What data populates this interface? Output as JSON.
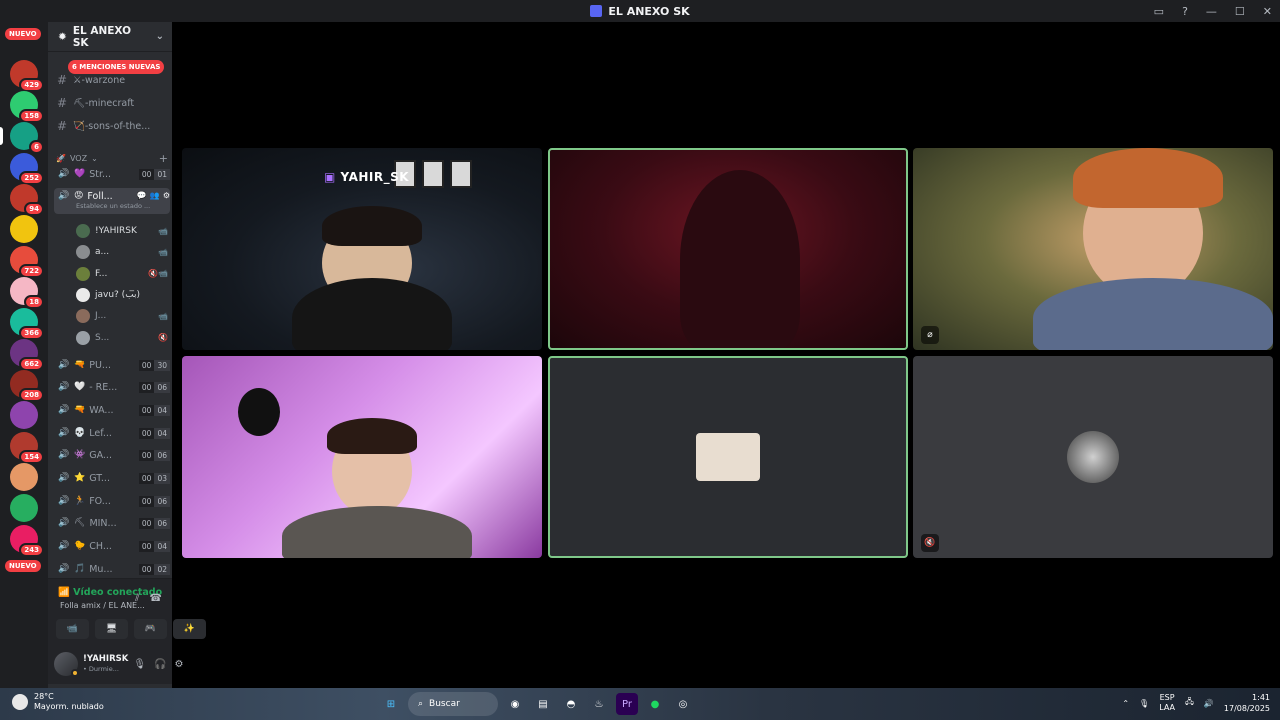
{
  "window": {
    "title": "EL ANEXO SK"
  },
  "rail": {
    "top_badge": "NUEVO",
    "bottom_badge": "NUEVO",
    "servers": [
      {
        "badge": "429",
        "color": "#c0392b"
      },
      {
        "badge": "158",
        "color": "#2ecc71"
      },
      {
        "badge": "6",
        "color": "#16a085"
      },
      {
        "badge": "252",
        "color": "#3b5bdb"
      },
      {
        "badge": "94",
        "color": "#c0392b"
      },
      {
        "badge": "",
        "color": "#f1c40f"
      },
      {
        "badge": "722",
        "color": "#e74c3c"
      },
      {
        "badge": "18",
        "color": "#f5b7c5"
      },
      {
        "badge": "366",
        "color": "#1abc9c"
      },
      {
        "badge": "662",
        "color": "#6c3483"
      },
      {
        "badge": "208",
        "color": "#922b21"
      },
      {
        "badge": "",
        "color": "#8e44ad"
      },
      {
        "badge": "154",
        "color": "#b03a2e"
      },
      {
        "badge": "",
        "color": "#e59866"
      },
      {
        "badge": "",
        "color": "#27ae60"
      },
      {
        "badge": "243",
        "color": "#e91e63"
      }
    ]
  },
  "guild": {
    "name": "EL ANEXO SK",
    "mentions": "6 MENCIONES NUEVAS",
    "text_channels": [
      "⚔-warzone",
      "⛏-minecraft",
      "🏹-sons-of-the..."
    ],
    "voice_category": "VOZ",
    "voice_channels": [
      {
        "emoji": "💜",
        "name": "Str...",
        "a": "00",
        "b": "01"
      },
      {
        "emoji": "😡",
        "name": "Foll...",
        "status": "Establece un estado ...",
        "active": true
      },
      {
        "emoji": "🔫",
        "name": "PU...",
        "a": "00",
        "b": "30"
      },
      {
        "emoji": "🤍",
        "name": "- RE...",
        "a": "00",
        "b": "06"
      },
      {
        "emoji": "🔫",
        "name": "WA...",
        "a": "00",
        "b": "04"
      },
      {
        "emoji": "💀",
        "name": "Lef...",
        "a": "00",
        "b": "04"
      },
      {
        "emoji": "👾",
        "name": "GA...",
        "a": "00",
        "b": "06"
      },
      {
        "emoji": "⭐",
        "name": "GT...",
        "a": "00",
        "b": "03"
      },
      {
        "emoji": "🏃",
        "name": "FO...",
        "a": "00",
        "b": "06"
      },
      {
        "emoji": "⛏",
        "name": "MIN...",
        "a": "00",
        "b": "06"
      },
      {
        "emoji": "🐤",
        "name": "CH...",
        "a": "00",
        "b": "04"
      },
      {
        "emoji": "🎵",
        "name": "Mu...",
        "a": "00",
        "b": "02"
      }
    ],
    "members": [
      {
        "name": "!YAHIRSK",
        "icon": "📹",
        "color": "#4a6b4f"
      },
      {
        "name": "a...",
        "icon": "📹",
        "color": "#8a8d90"
      },
      {
        "name": "F...",
        "icon": "🔇📹",
        "color": "#6b7f3b"
      },
      {
        "name": "javu? (ب̅ب)",
        "icon": "",
        "color": "#eaeaea"
      },
      {
        "name": "J...",
        "icon": "📹",
        "color": "#8a6b5c"
      },
      {
        "name": "S...",
        "icon": "🔇",
        "color": "#9aa0a6"
      }
    ]
  },
  "voice_panel": {
    "status": "Vídeo conectado",
    "channel": "Folla amix / EL ANE...",
    "buttons": [
      "📹",
      "🖥",
      "🎮",
      "✨"
    ]
  },
  "user": {
    "name": "!YAHIRSK",
    "status": "• Durmie..."
  },
  "tiles": {
    "t1_overlay": "YAHIR_SK"
  },
  "taskbar": {
    "temp": "28°C",
    "weather": "Mayorm. nublado",
    "search": "Buscar",
    "lang1": "ESP",
    "lang2": "LAA",
    "time": "1:41",
    "date": "17/08/2025"
  }
}
